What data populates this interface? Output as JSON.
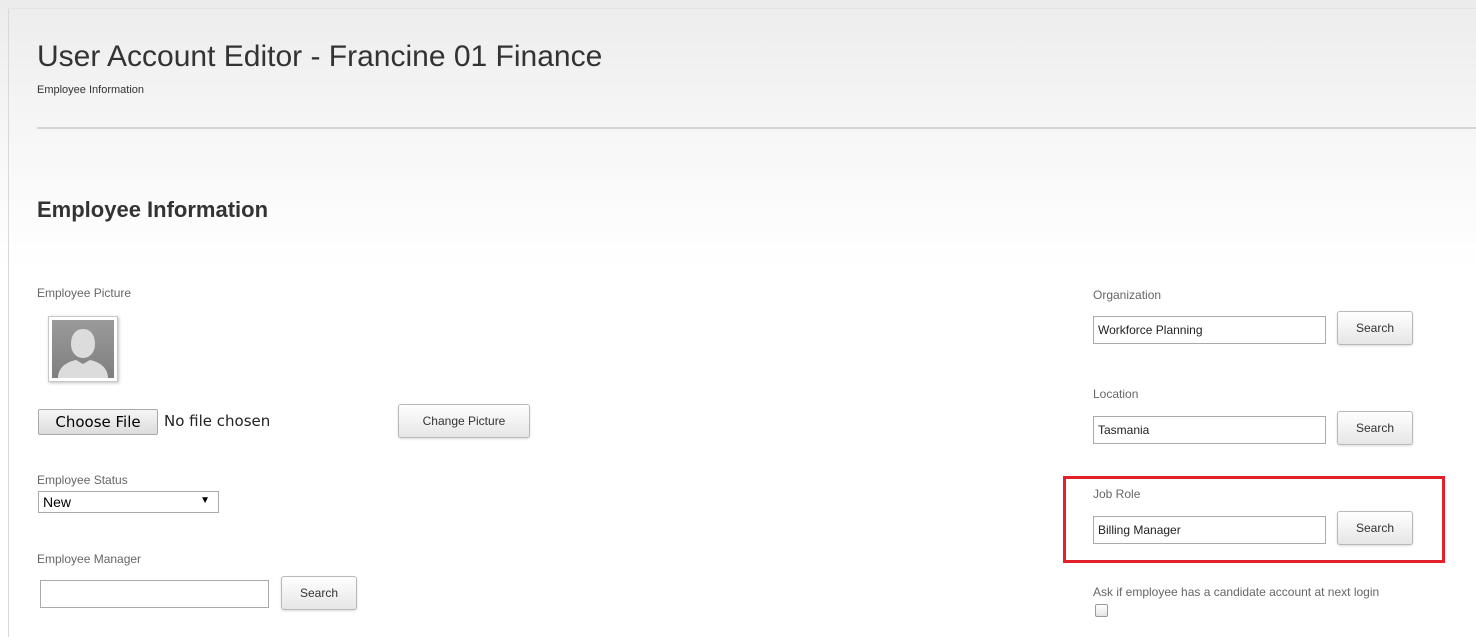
{
  "page": {
    "title": "User Account Editor - Francine 01 Finance",
    "subtitle": "Employee Information"
  },
  "section": {
    "title": "Employee Information"
  },
  "picture": {
    "label": "Employee Picture",
    "choose_file_label": "Choose File",
    "file_status": "No file chosen",
    "change_button": "Change Picture"
  },
  "status": {
    "label": "Employee Status",
    "selected": "New"
  },
  "manager": {
    "label": "Employee Manager",
    "value": "",
    "search_button": "Search"
  },
  "organization": {
    "label": "Organization",
    "value": "Workforce Planning",
    "search_button": "Search"
  },
  "location": {
    "label": "Location",
    "value": "Tasmania",
    "search_button": "Search"
  },
  "job_role": {
    "label": "Job Role",
    "value": "Billing Manager",
    "search_button": "Search",
    "highlight_color": "#e3202a"
  },
  "candidate": {
    "label": "Ask if employee has a candidate account at next login",
    "checked": false
  },
  "icons": {
    "avatar": "person-silhouette-icon",
    "dropdown": "caret-down-icon"
  }
}
